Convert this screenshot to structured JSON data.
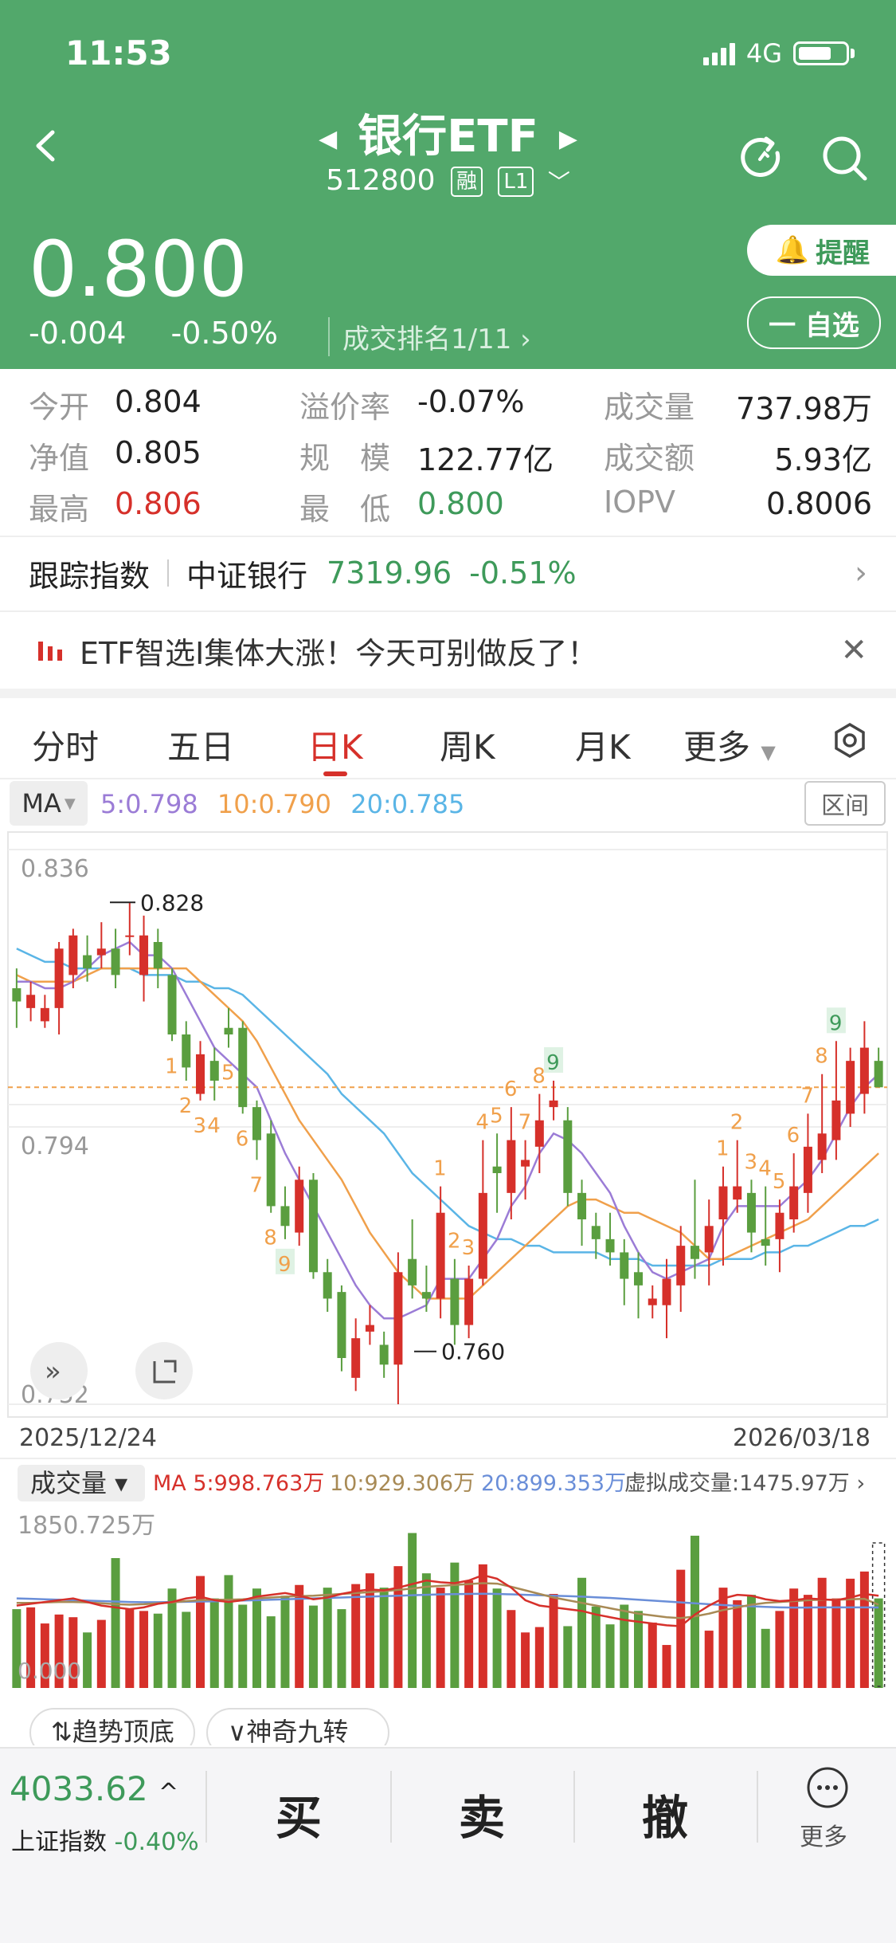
{
  "status": {
    "time": "11:53",
    "network": "4G"
  },
  "header": {
    "title": "银行ETF",
    "code": "512800",
    "tag_margin": "融",
    "tag_level": "L1",
    "price": "0.800",
    "change": "-0.004",
    "change_pct": "-0.50%",
    "rank": "成交排名1/11",
    "remind": "提醒",
    "favorite": "一 自选"
  },
  "stats": {
    "open_label": "今开",
    "open": "0.804",
    "premium_label": "溢价率",
    "premium": "-0.07%",
    "volume_label": "成交量",
    "volume": "737.98万",
    "nav_label": "净值",
    "nav": "0.805",
    "scale_label": "规　模",
    "scale": "122.77亿",
    "amount_label": "成交额",
    "amount": "5.93亿",
    "high_label": "最高",
    "high": "0.806",
    "low_label": "最　低",
    "low": "0.800",
    "iopv_label": "IOPV",
    "iopv": "0.8006"
  },
  "tracking": {
    "label": "跟踪指数",
    "name": "中证银行",
    "value": "7319.96",
    "pct": "-0.51%"
  },
  "banner": {
    "text": "ETF智选I集体大涨！今天可别做反了！"
  },
  "tabs": [
    "分时",
    "五日",
    "日K",
    "周K",
    "月K",
    "更多"
  ],
  "active_tab": "日K",
  "ma_legend": {
    "btn": "MA",
    "ma5": "5:0.798",
    "ma10": "10:0.790",
    "ma20": "20:0.785",
    "range": "区间"
  },
  "chart_data": {
    "type": "candlestick",
    "y_ticks": [
      "0.836",
      "0.794",
      "0.752"
    ],
    "ylim": [
      0.752,
      0.836
    ],
    "start_date": "2025/12/24",
    "end_date": "2026/03/18",
    "high_marker": "0.828",
    "low_marker": "0.760",
    "candles": [
      [
        0.815,
        0.813,
        0.818,
        0.809
      ],
      [
        0.812,
        0.814,
        0.816,
        0.81
      ],
      [
        0.81,
        0.812,
        0.814,
        0.809
      ],
      [
        0.812,
        0.821,
        0.822,
        0.808
      ],
      [
        0.817,
        0.823,
        0.824,
        0.815
      ],
      [
        0.82,
        0.818,
        0.823,
        0.816
      ],
      [
        0.82,
        0.821,
        0.825,
        0.818
      ],
      [
        0.821,
        0.817,
        0.824,
        0.815
      ],
      [
        0.823,
        0.823,
        0.828,
        0.82
      ],
      [
        0.817,
        0.823,
        0.826,
        0.813
      ],
      [
        0.822,
        0.818,
        0.824,
        0.815
      ],
      [
        0.817,
        0.808,
        0.818,
        0.807
      ],
      [
        0.808,
        0.803,
        0.81,
        0.801
      ],
      [
        0.799,
        0.805,
        0.807,
        0.798
      ],
      [
        0.804,
        0.801,
        0.806,
        0.798
      ],
      [
        0.809,
        0.808,
        0.812,
        0.806
      ],
      [
        0.809,
        0.797,
        0.81,
        0.796
      ],
      [
        0.797,
        0.792,
        0.798,
        0.789
      ],
      [
        0.793,
        0.782,
        0.795,
        0.781
      ],
      [
        0.782,
        0.779,
        0.785,
        0.777
      ],
      [
        0.778,
        0.786,
        0.788,
        0.776
      ],
      [
        0.786,
        0.772,
        0.787,
        0.771
      ],
      [
        0.772,
        0.768,
        0.774,
        0.766
      ],
      [
        0.769,
        0.759,
        0.77,
        0.757
      ],
      [
        0.756,
        0.762,
        0.765,
        0.754
      ],
      [
        0.763,
        0.764,
        0.767,
        0.761
      ],
      [
        0.761,
        0.758,
        0.763,
        0.756
      ],
      [
        0.758,
        0.772,
        0.775,
        0.752
      ],
      [
        0.774,
        0.77,
        0.78,
        0.768
      ],
      [
        0.769,
        0.768,
        0.773,
        0.766
      ],
      [
        0.768,
        0.781,
        0.785,
        0.765
      ],
      [
        0.771,
        0.764,
        0.774,
        0.761
      ],
      [
        0.764,
        0.771,
        0.773,
        0.762
      ],
      [
        0.771,
        0.784,
        0.792,
        0.77
      ],
      [
        0.788,
        0.787,
        0.793,
        0.781
      ],
      [
        0.784,
        0.792,
        0.797,
        0.78
      ],
      [
        0.788,
        0.789,
        0.792,
        0.783
      ],
      [
        0.791,
        0.795,
        0.799,
        0.787
      ],
      [
        0.797,
        0.798,
        0.801,
        0.795
      ],
      [
        0.795,
        0.784,
        0.797,
        0.782
      ],
      [
        0.784,
        0.78,
        0.786,
        0.776
      ],
      [
        0.779,
        0.777,
        0.781,
        0.774
      ],
      [
        0.777,
        0.775,
        0.781,
        0.773
      ],
      [
        0.775,
        0.771,
        0.777,
        0.767
      ],
      [
        0.772,
        0.77,
        0.775,
        0.765
      ],
      [
        0.767,
        0.768,
        0.77,
        0.765
      ],
      [
        0.767,
        0.771,
        0.774,
        0.762
      ],
      [
        0.77,
        0.776,
        0.779,
        0.766
      ],
      [
        0.776,
        0.774,
        0.786,
        0.771
      ],
      [
        0.775,
        0.779,
        0.783,
        0.77
      ],
      [
        0.78,
        0.785,
        0.788,
        0.773
      ],
      [
        0.783,
        0.785,
        0.792,
        0.781
      ],
      [
        0.784,
        0.778,
        0.786,
        0.775
      ],
      [
        0.777,
        0.776,
        0.785,
        0.773
      ],
      [
        0.777,
        0.781,
        0.783,
        0.772
      ],
      [
        0.78,
        0.785,
        0.79,
        0.778
      ],
      [
        0.784,
        0.791,
        0.796,
        0.781
      ],
      [
        0.789,
        0.793,
        0.802,
        0.787
      ],
      [
        0.792,
        0.798,
        0.807,
        0.789
      ],
      [
        0.796,
        0.804,
        0.806,
        0.794
      ],
      [
        0.799,
        0.806,
        0.81,
        0.796
      ],
      [
        0.804,
        0.8,
        0.806,
        0.8
      ]
    ],
    "ma5": [
      0.816,
      0.816,
      0.815,
      0.815,
      0.816,
      0.818,
      0.82,
      0.821,
      0.822,
      0.82,
      0.82,
      0.818,
      0.814,
      0.81,
      0.806,
      0.804,
      0.802,
      0.8,
      0.795,
      0.79,
      0.786,
      0.782,
      0.778,
      0.774,
      0.77,
      0.767,
      0.765,
      0.765,
      0.766,
      0.767,
      0.771,
      0.771,
      0.771,
      0.774,
      0.777,
      0.782,
      0.785,
      0.79,
      0.793,
      0.792,
      0.79,
      0.787,
      0.784,
      0.779,
      0.775,
      0.772,
      0.771,
      0.772,
      0.773,
      0.774,
      0.779,
      0.782,
      0.782,
      0.782,
      0.782,
      0.784,
      0.786,
      0.789,
      0.793,
      0.797,
      0.8,
      0.802
    ],
    "ma10": [
      0.817,
      0.816,
      0.816,
      0.816,
      0.816,
      0.817,
      0.818,
      0.818,
      0.818,
      0.818,
      0.818,
      0.818,
      0.818,
      0.816,
      0.814,
      0.812,
      0.81,
      0.807,
      0.803,
      0.799,
      0.795,
      0.792,
      0.789,
      0.786,
      0.782,
      0.778,
      0.775,
      0.772,
      0.77,
      0.768,
      0.768,
      0.768,
      0.768,
      0.77,
      0.772,
      0.774,
      0.776,
      0.778,
      0.78,
      0.782,
      0.783,
      0.783,
      0.782,
      0.781,
      0.781,
      0.78,
      0.779,
      0.778,
      0.776,
      0.774,
      0.774,
      0.775,
      0.776,
      0.777,
      0.778,
      0.779,
      0.78,
      0.782,
      0.784,
      0.786,
      0.788,
      0.79
    ],
    "ma20": [
      0.821,
      0.82,
      0.819,
      0.819,
      0.818,
      0.818,
      0.818,
      0.818,
      0.818,
      0.817,
      0.817,
      0.817,
      0.816,
      0.816,
      0.815,
      0.815,
      0.814,
      0.812,
      0.81,
      0.808,
      0.806,
      0.804,
      0.802,
      0.799,
      0.797,
      0.795,
      0.793,
      0.79,
      0.787,
      0.785,
      0.783,
      0.781,
      0.779,
      0.778,
      0.777,
      0.777,
      0.776,
      0.776,
      0.775,
      0.775,
      0.775,
      0.775,
      0.774,
      0.774,
      0.774,
      0.773,
      0.773,
      0.773,
      0.773,
      0.773,
      0.774,
      0.774,
      0.774,
      0.775,
      0.775,
      0.776,
      0.776,
      0.777,
      0.778,
      0.779,
      0.779,
      0.78
    ],
    "td_markers": [
      {
        "i": 11,
        "n": "1"
      },
      {
        "i": 12,
        "n": "2"
      },
      {
        "i": 13,
        "n": "3"
      },
      {
        "i": 14,
        "n": "4"
      },
      {
        "i": 15,
        "n": "5"
      },
      {
        "i": 16,
        "n": "6"
      },
      {
        "i": 17,
        "n": "7"
      },
      {
        "i": 18,
        "n": "8"
      },
      {
        "i": 19,
        "n": "9"
      },
      {
        "i": 30,
        "n": "1"
      },
      {
        "i": 31,
        "n": "2"
      },
      {
        "i": 32,
        "n": "3"
      },
      {
        "i": 33,
        "n": "4"
      },
      {
        "i": 34,
        "n": "5"
      },
      {
        "i": 35,
        "n": "6"
      },
      {
        "i": 36,
        "n": "7"
      },
      {
        "i": 37,
        "n": "8"
      },
      {
        "i": 38,
        "n": "9"
      },
      {
        "i": 50,
        "n": "1"
      },
      {
        "i": 51,
        "n": "2"
      },
      {
        "i": 52,
        "n": "3"
      },
      {
        "i": 53,
        "n": "4"
      },
      {
        "i": 54,
        "n": "5"
      },
      {
        "i": 55,
        "n": "6"
      },
      {
        "i": 56,
        "n": "7"
      },
      {
        "i": 57,
        "n": "8"
      },
      {
        "i": 58,
        "n": "9"
      }
    ],
    "volume": {
      "label": "成交量",
      "ma5": "MA 5:998.763万",
      "ma10": "10:929.306万",
      "ma20": "20:899.353万",
      "virtual": "虚拟成交量:1475.97万",
      "max_label": "1850.725万",
      "zero_label": "0.000",
      "max": 1850.725,
      "values": [
        880,
        900,
        720,
        820,
        790,
        620,
        760,
        1450,
        880,
        860,
        830,
        1110,
        850,
        1250,
        1000,
        1260,
        930,
        1110,
        800,
        1030,
        1150,
        920,
        1120,
        880,
        1160,
        1280,
        1120,
        1360,
        1730,
        1280,
        1120,
        1400,
        1200,
        1380,
        1110,
        870,
        620,
        680,
        1050,
        690,
        1230,
        910,
        710,
        930,
        860,
        730,
        480,
        1320,
        1700,
        640,
        1120,
        980,
        1040,
        660,
        860,
        1110,
        1040,
        1230,
        1000,
        1220,
        1300,
        1000
      ],
      "ma5_series": [
        920,
        940,
        960,
        980,
        1000,
        960,
        920,
        900,
        880,
        900,
        940,
        960,
        1000,
        1020,
        980,
        960,
        980,
        1020,
        1040,
        1060,
        1030,
        990,
        1010,
        1050,
        1080,
        1100,
        1090,
        1120,
        1160,
        1200,
        1180,
        1170,
        1200,
        1260,
        1220,
        1120,
        980,
        920,
        900,
        880,
        860,
        820,
        790,
        760,
        740,
        720,
        700,
        690,
        820,
        920,
        1000,
        1040,
        1030,
        990,
        970,
        980,
        1000,
        990,
        980,
        1010,
        1050,
        1030
      ],
      "ma10_series": [
        950,
        950,
        955,
        960,
        960,
        955,
        945,
        935,
        930,
        935,
        945,
        955,
        970,
        980,
        985,
        985,
        990,
        1000,
        1010,
        1020,
        1025,
        1030,
        1040,
        1050,
        1060,
        1070,
        1080,
        1095,
        1110,
        1130,
        1140,
        1150,
        1160,
        1170,
        1165,
        1130,
        1090,
        1050,
        1010,
        980,
        950,
        920,
        890,
        860,
        830,
        810,
        790,
        780,
        800,
        830,
        870,
        900,
        930,
        950,
        960,
        970,
        980,
        985,
        985,
        990,
        995,
        930
      ],
      "ma20_series": [
        1000,
        995,
        990,
        985,
        980,
        975,
        970,
        965,
        960,
        958,
        958,
        960,
        962,
        965,
        968,
        972,
        976,
        980,
        985,
        990,
        995,
        1000,
        1005,
        1010,
        1015,
        1020,
        1025,
        1030,
        1035,
        1040,
        1045,
        1048,
        1050,
        1052,
        1050,
        1045,
        1040,
        1035,
        1030,
        1025,
        1020,
        1012,
        1005,
        995,
        985,
        975,
        965,
        955,
        945,
        935,
        925,
        918,
        912,
        905,
        900,
        898,
        898,
        900,
        900,
        900,
        900,
        899
      ]
    },
    "chips": [
      "趋势顶底",
      "神奇九转"
    ]
  },
  "bottom": {
    "index_value": "4033.62",
    "index_name": "上证指数",
    "index_pct": "-0.40%",
    "buy": "买",
    "sell": "卖",
    "cancel": "撤",
    "more": "更多"
  },
  "colors": {
    "up": "#d6302a",
    "down": "#5a9e3f",
    "header": "#52a86b",
    "ma5": "#9b7cd6",
    "ma10": "#f0a04b",
    "ma20": "#5ab5e6"
  }
}
